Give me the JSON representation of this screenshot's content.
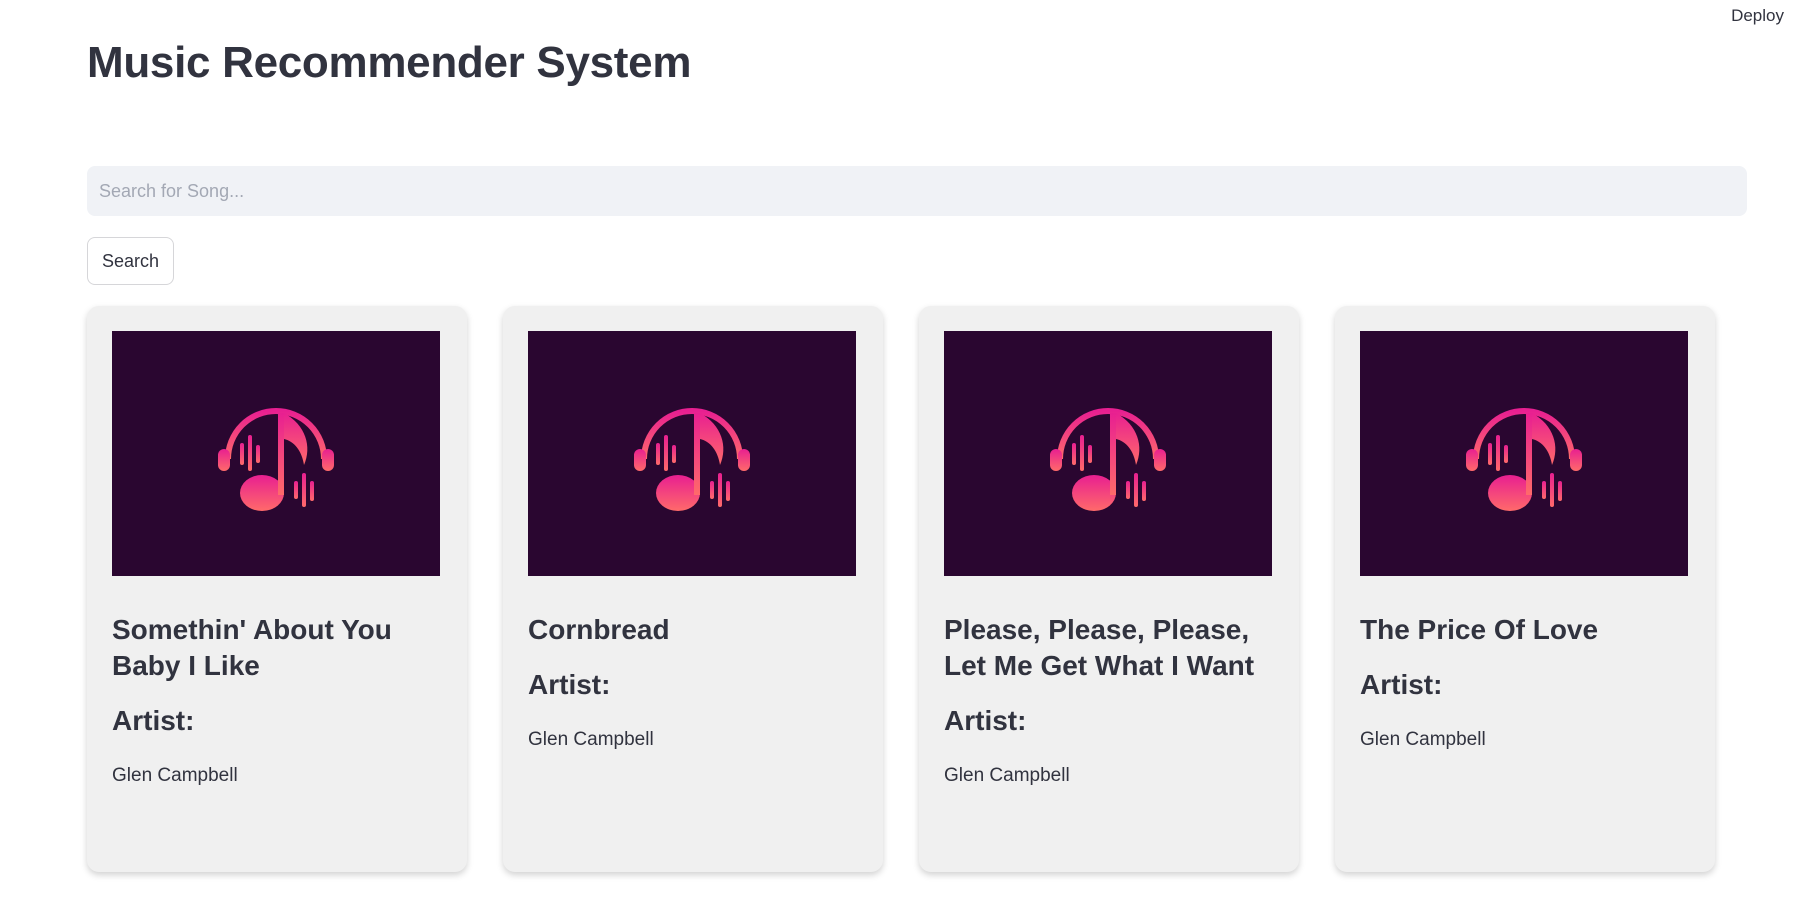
{
  "header": {
    "deploy_label": "Deploy"
  },
  "title": "Music Recommender System",
  "search": {
    "placeholder": "Search for Song...",
    "value": "",
    "button_label": "Search"
  },
  "artist_label": "Artist:",
  "colors": {
    "thumb_bg": "#2a0630",
    "icon_pink": "#f0278d",
    "icon_coral": "#ff6a6a"
  },
  "thumbnail_icon": "headphones-music-note-icon",
  "songs": [
    {
      "title": "Somethin' About You Baby I Like",
      "artist": "Glen Campbell"
    },
    {
      "title": "Cornbread",
      "artist": "Glen Campbell"
    },
    {
      "title": "Please, Please, Please, Let Me Get What I Want",
      "artist": "Glen Campbell"
    },
    {
      "title": "The Price Of Love",
      "artist": "Glen Campbell"
    }
  ]
}
